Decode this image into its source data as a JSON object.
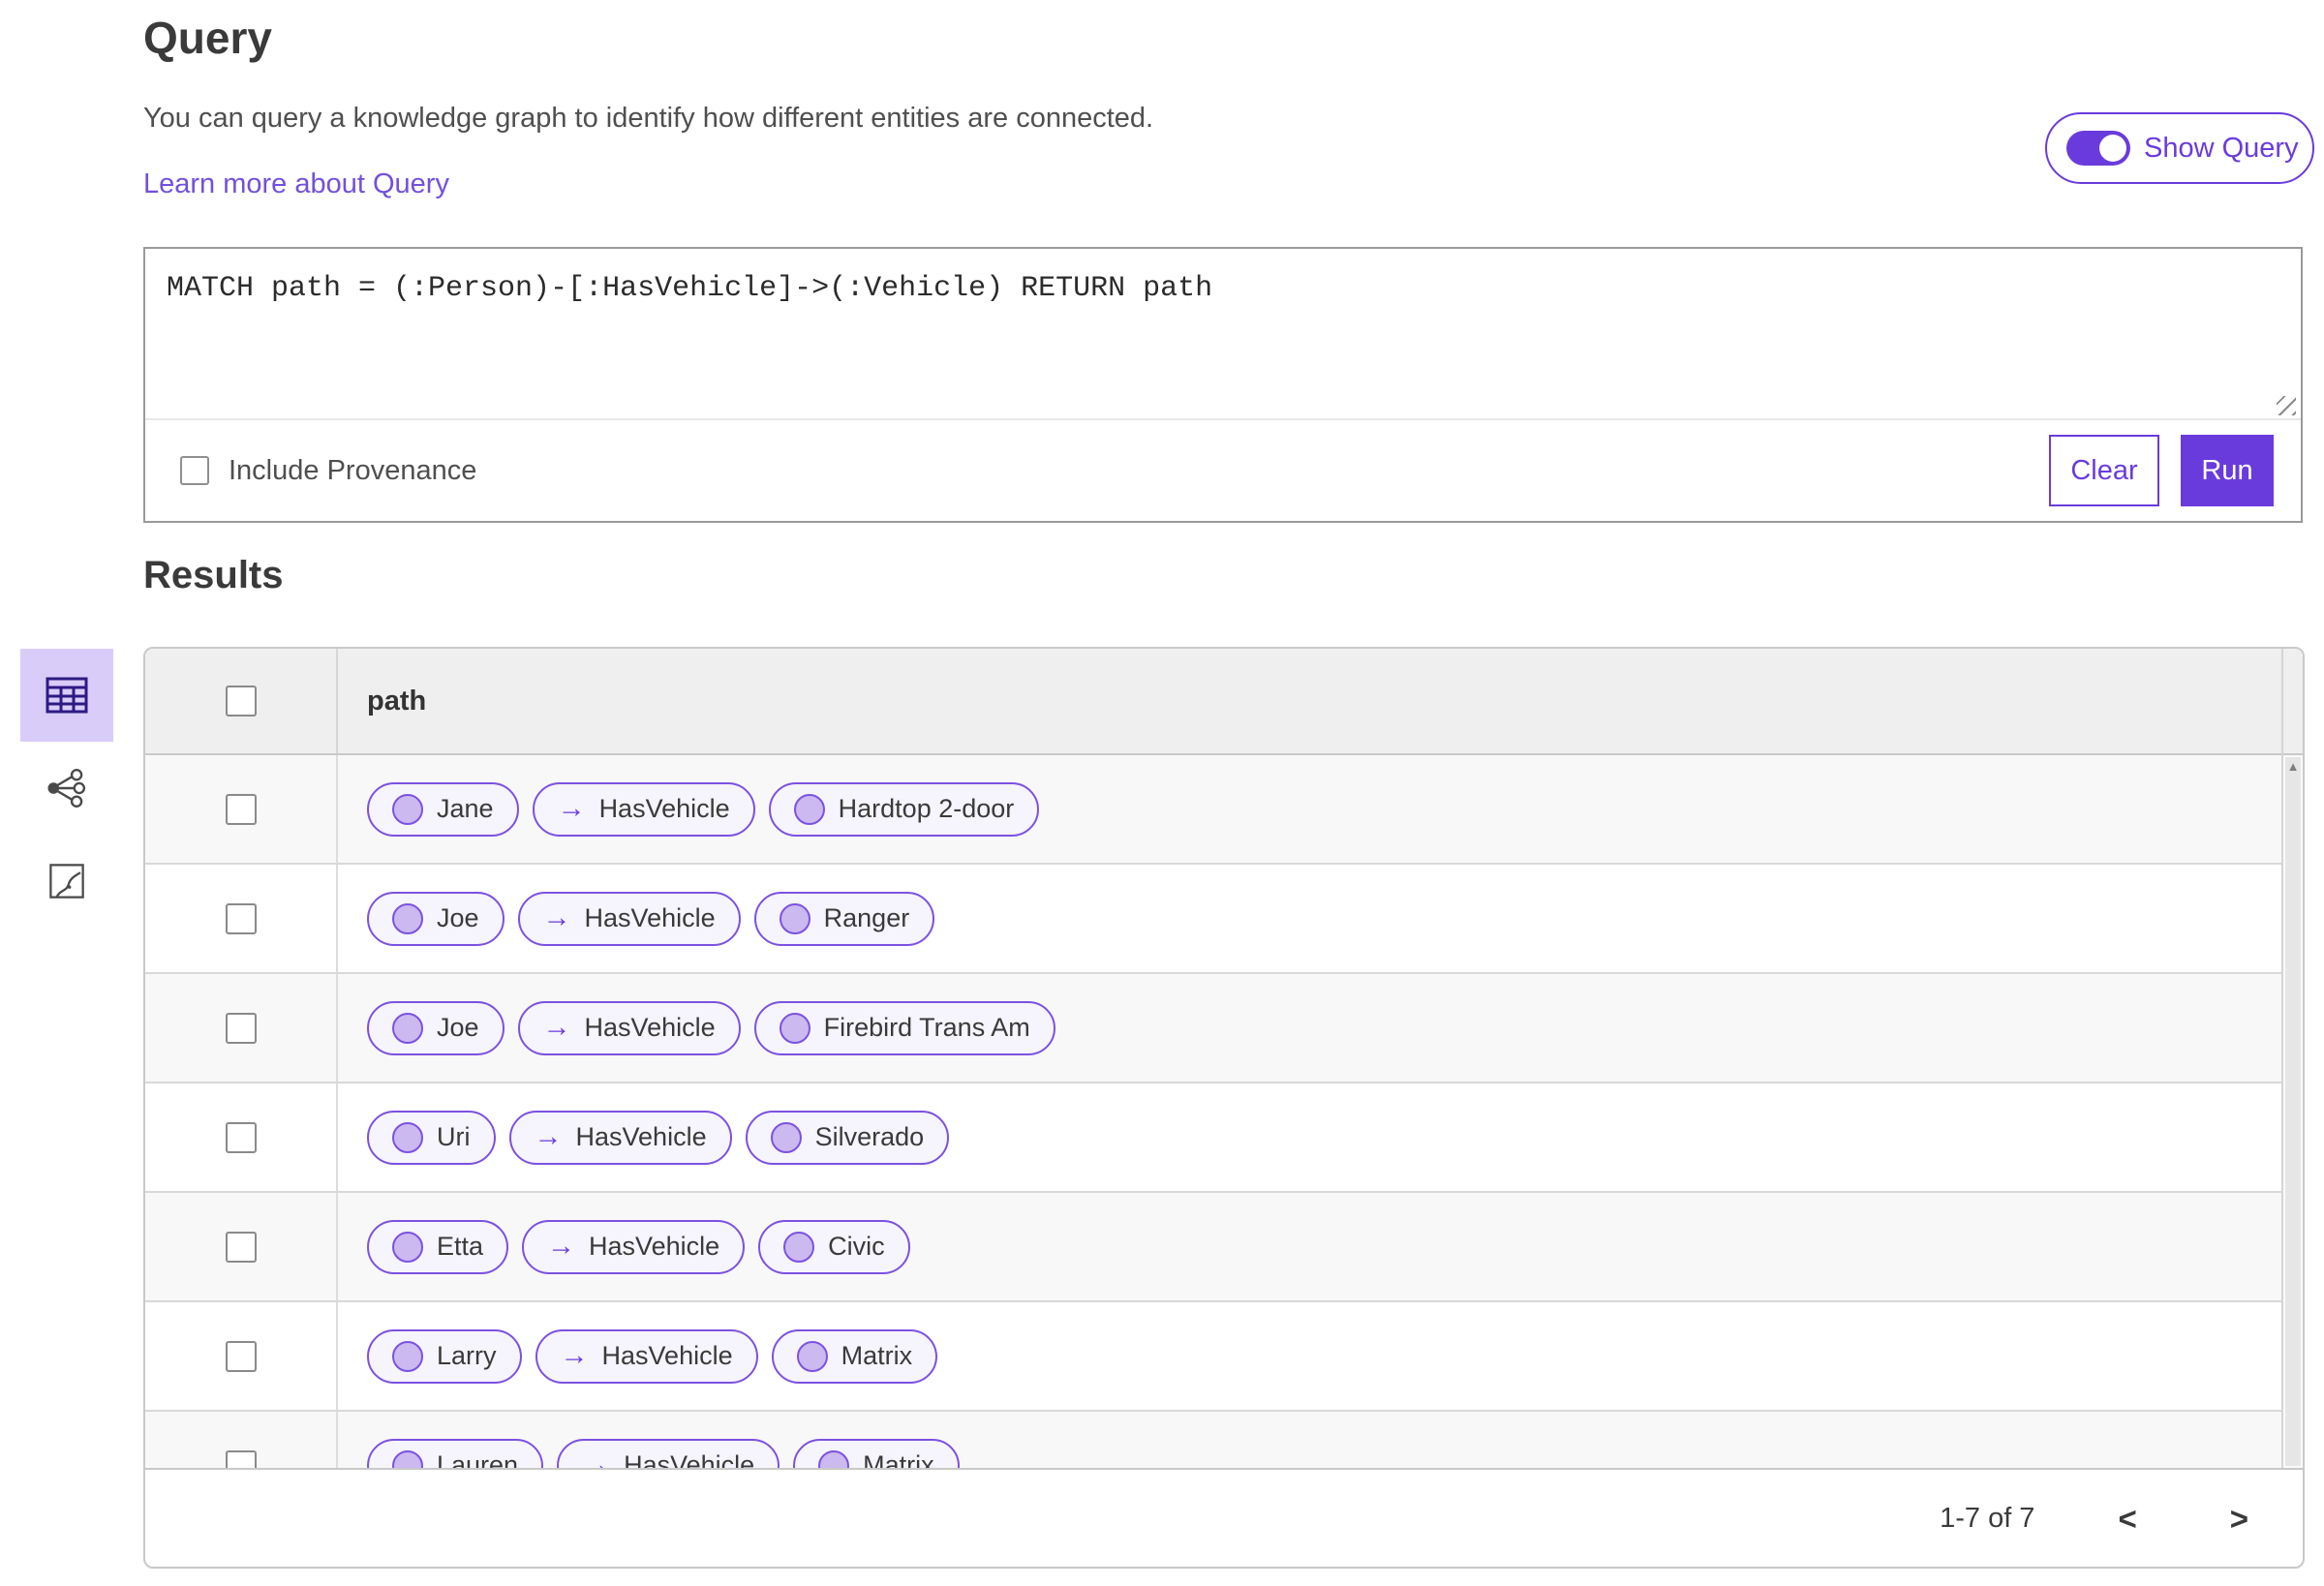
{
  "colors": {
    "accent_purple": "#6A3BDC",
    "pill_border": "#7C52E0",
    "pill_background": "#F6F4FD",
    "pill_circle": "#CBB9F0",
    "selected_view_background": "#D9CCF9",
    "link": "#7350DC"
  },
  "query": {
    "title": "Query",
    "description": "You can query a knowledge graph to identify how different entities are connected.",
    "learn_more_label": "Learn more about Query",
    "show_query_label": "Show Query",
    "query_text": "MATCH path = (:Person)-[:HasVehicle]->(:Vehicle) RETURN path",
    "include_provenance_label": "Include Provenance",
    "clear_label": "Clear",
    "run_label": "Run"
  },
  "results": {
    "title": "Results",
    "column_header": "path",
    "relation_arrow": "→",
    "rows": [
      {
        "source": "Jane",
        "relation": "HasVehicle",
        "target": "Hardtop 2-door"
      },
      {
        "source": "Joe",
        "relation": "HasVehicle",
        "target": "Ranger"
      },
      {
        "source": "Joe",
        "relation": "HasVehicle",
        "target": "Firebird Trans Am"
      },
      {
        "source": "Uri",
        "relation": "HasVehicle",
        "target": "Silverado"
      },
      {
        "source": "Etta",
        "relation": "HasVehicle",
        "target": "Civic"
      },
      {
        "source": "Larry",
        "relation": "HasVehicle",
        "target": "Matrix"
      },
      {
        "source": "Lauren",
        "relation": "HasVehicle",
        "target": "Matrix"
      }
    ],
    "pagination": {
      "range_label": "1-7 of 7",
      "prev_label": "<",
      "next_label": ">"
    }
  }
}
